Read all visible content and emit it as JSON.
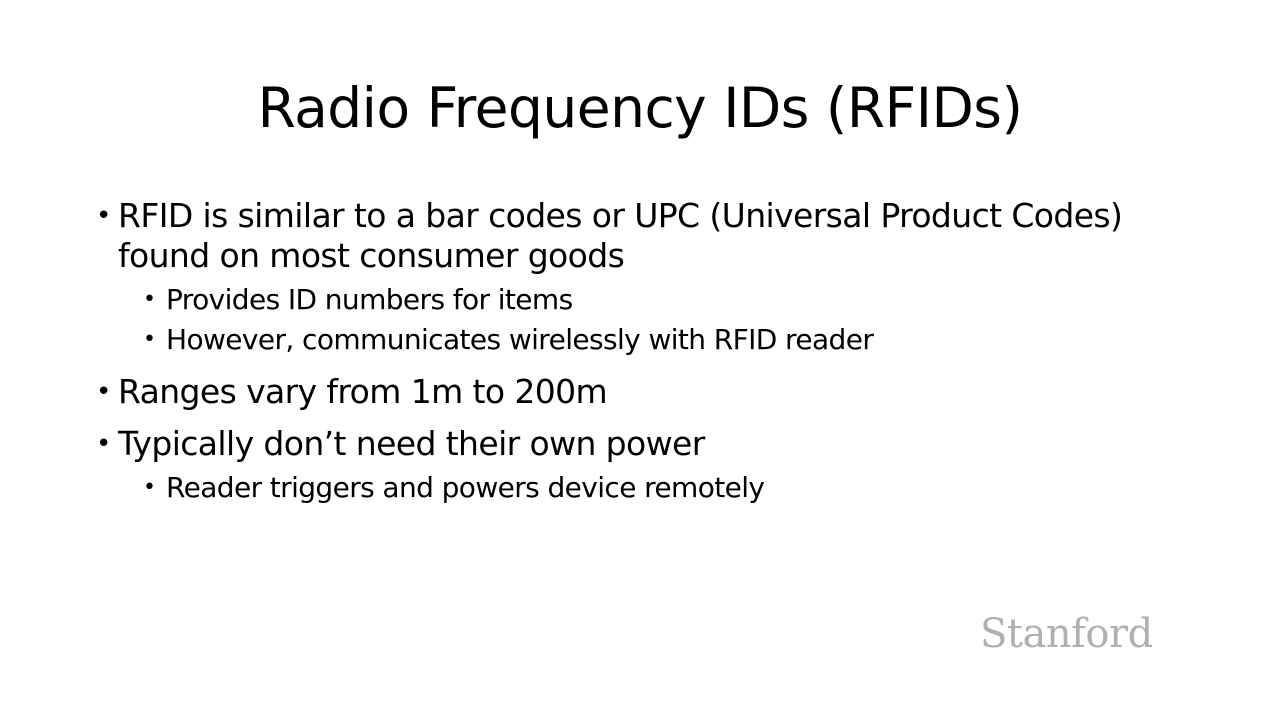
{
  "slide": {
    "title": "Radio Frequency IDs (RFIDs)",
    "bullets": [
      {
        "text": "RFID is similar to a bar codes or UPC (Universal Product Codes) found on most consumer goods",
        "sub": [
          "Provides ID numbers for items",
          "However, communicates wirelessly with RFID reader"
        ]
      },
      {
        "text": "Ranges vary from 1m to 200m",
        "sub": []
      },
      {
        "text": "Typically don’t need their own power",
        "sub": [
          "Reader triggers and powers device remotely"
        ]
      }
    ],
    "bullet_glyph": "•",
    "logo_text": "Stanford"
  }
}
